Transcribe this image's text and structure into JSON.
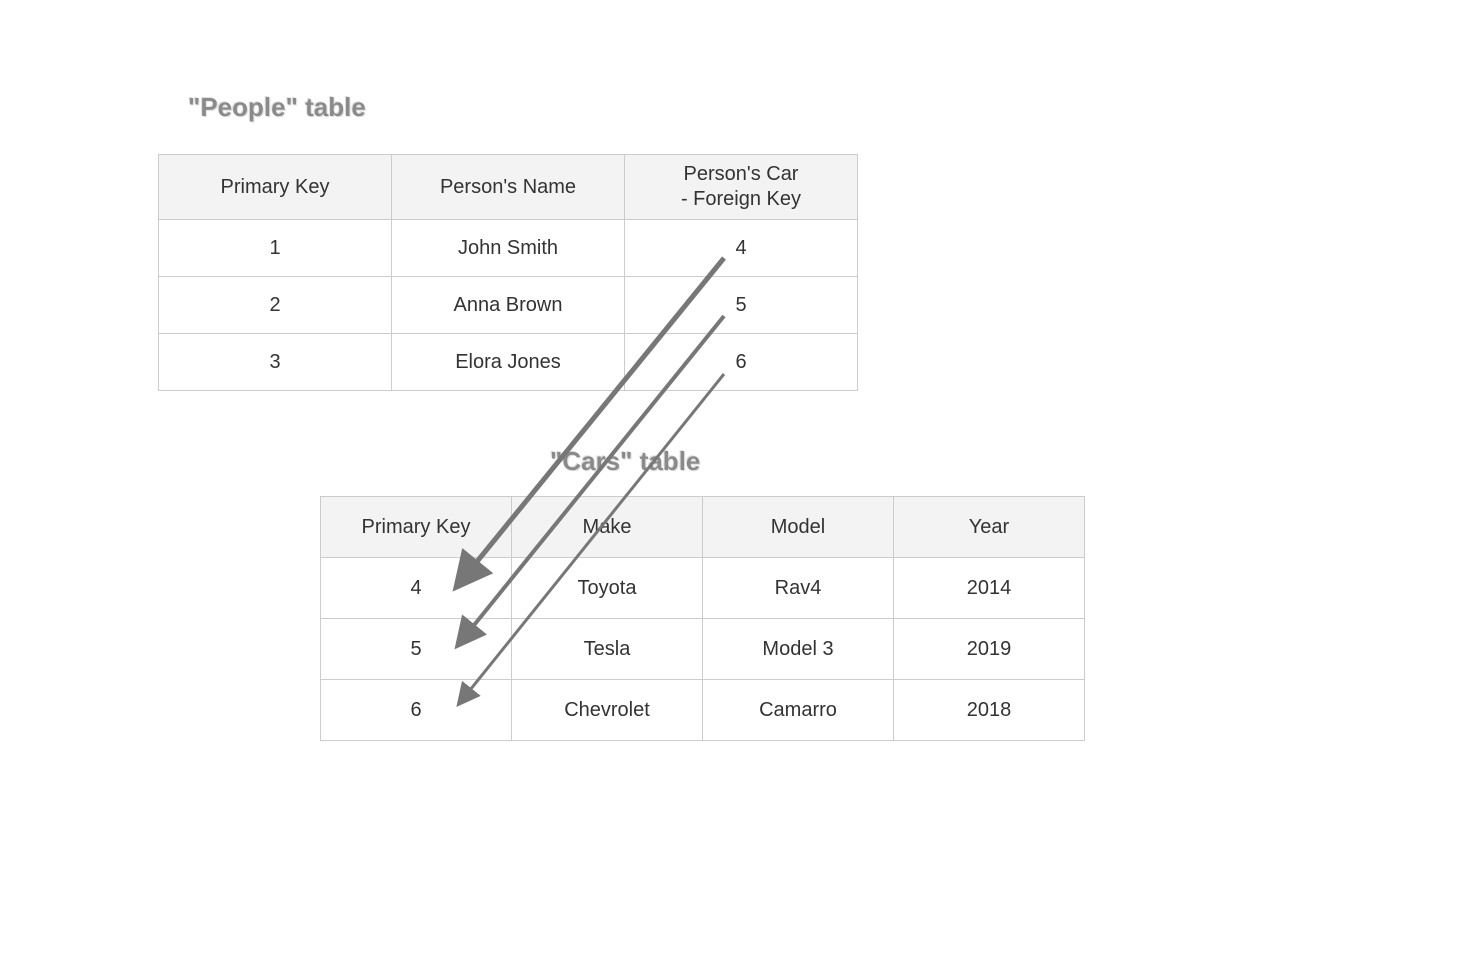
{
  "people": {
    "title": "\"People\" table",
    "headers": {
      "pk": "Primary Key",
      "name": "Person's Name",
      "car_line1": "Person's Car",
      "car_line2": "- Foreign Key"
    },
    "rows": [
      {
        "pk": "1",
        "name": "John Smith",
        "car_fk": "4"
      },
      {
        "pk": "2",
        "name": "Anna Brown",
        "car_fk": "5"
      },
      {
        "pk": "3",
        "name": "Elora Jones",
        "car_fk": "6"
      }
    ]
  },
  "cars": {
    "title": "\"Cars\" table",
    "headers": {
      "pk": "Primary Key",
      "make": "Make",
      "model": "Model",
      "year": "Year"
    },
    "rows": [
      {
        "pk": "4",
        "make": "Toyota",
        "model": "Rav4",
        "year": "2014"
      },
      {
        "pk": "5",
        "make": "Tesla",
        "model": "Model 3",
        "year": "2019"
      },
      {
        "pk": "6",
        "make": "Chevrolet",
        "model": "Camarro",
        "year": "2018"
      }
    ]
  }
}
